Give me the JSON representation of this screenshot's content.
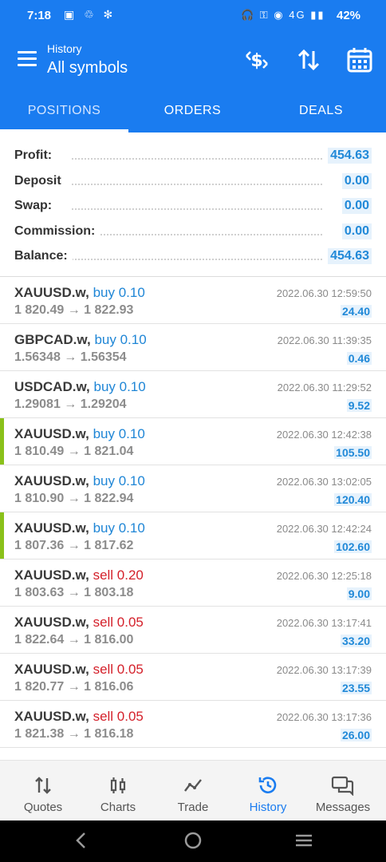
{
  "status": {
    "time": "7:18",
    "battery": "42%",
    "network": "4G",
    "left_icons": "▣ ♲ ✻",
    "right_icons": "🎧 ⚿ ◉ 4G ▮▮ "
  },
  "header": {
    "subtitle": "History",
    "title": "All symbols",
    "icons": [
      "currency-exchange-icon",
      "sort-icon",
      "calendar-icon"
    ]
  },
  "tabs": [
    {
      "label": "POSITIONS",
      "active": true
    },
    {
      "label": "ORDERS",
      "active": false
    },
    {
      "label": "DEALS",
      "active": false
    }
  ],
  "summary": [
    {
      "label": "Profit:",
      "value": "454.63"
    },
    {
      "label": "Deposit",
      "value": "0.00"
    },
    {
      "label": "Swap:",
      "value": "0.00"
    },
    {
      "label": "Commission:",
      "value": "0.00"
    },
    {
      "label": "Balance:",
      "value": "454.63"
    }
  ],
  "positions": [
    {
      "symbol": "XAUUSD.w,",
      "side": "buy 0.10",
      "prices": "1 820.49 → 1 822.93",
      "time": "2022.06.30 12:59:50",
      "profit": "24.40",
      "highlight": false
    },
    {
      "symbol": "GBPCAD.w,",
      "side": "buy 0.10",
      "prices": "1.56348 → 1.56354",
      "time": "2022.06.30 11:39:35",
      "profit": "0.46",
      "highlight": false
    },
    {
      "symbol": "USDCAD.w,",
      "side": "buy 0.10",
      "prices": "1.29081 → 1.29204",
      "time": "2022.06.30 11:29:52",
      "profit": "9.52",
      "highlight": false
    },
    {
      "symbol": "XAUUSD.w,",
      "side": "buy 0.10",
      "prices": "1 810.49 → 1 821.04",
      "time": "2022.06.30 12:42:38",
      "profit": "105.50",
      "highlight": true
    },
    {
      "symbol": "XAUUSD.w,",
      "side": "buy 0.10",
      "prices": "1 810.90 → 1 822.94",
      "time": "2022.06.30 13:02:05",
      "profit": "120.40",
      "highlight": false
    },
    {
      "symbol": "XAUUSD.w,",
      "side": "buy 0.10",
      "prices": "1 807.36 → 1 817.62",
      "time": "2022.06.30 12:42:24",
      "profit": "102.60",
      "highlight": true
    },
    {
      "symbol": "XAUUSD.w,",
      "side": "sell 0.20",
      "prices": "1 803.63 → 1 803.18",
      "time": "2022.06.30 12:25:18",
      "profit": "9.00",
      "highlight": false
    },
    {
      "symbol": "XAUUSD.w,",
      "side": "sell 0.05",
      "prices": "1 822.64 → 1 816.00",
      "time": "2022.06.30 13:17:41",
      "profit": "33.20",
      "highlight": false
    },
    {
      "symbol": "XAUUSD.w,",
      "side": "sell 0.05",
      "prices": "1 820.77 → 1 816.06",
      "time": "2022.06.30 13:17:39",
      "profit": "23.55",
      "highlight": false
    },
    {
      "symbol": "XAUUSD.w,",
      "side": "sell 0.05",
      "prices": "1 821.38 → 1 816.18",
      "time": "2022.06.30 13:17:36",
      "profit": "26.00",
      "highlight": false
    }
  ],
  "nav": [
    {
      "label": "Quotes",
      "icon": "quotes-icon",
      "glyph": "⇅",
      "active": false
    },
    {
      "label": "Charts",
      "icon": "charts-icon",
      "glyph": "⫾⫾",
      "active": false
    },
    {
      "label": "Trade",
      "icon": "trade-icon",
      "glyph": "〰",
      "active": false
    },
    {
      "label": "History",
      "icon": "history-icon",
      "glyph": "⟲",
      "active": true
    },
    {
      "label": "Messages",
      "icon": "messages-icon",
      "glyph": "⧉",
      "active": false
    }
  ],
  "colors": {
    "primary": "#1a7cf0",
    "buy": "#1f86d6",
    "sell": "#d4202a",
    "profit": "#2189d8",
    "highlight": "#8ac11a"
  }
}
